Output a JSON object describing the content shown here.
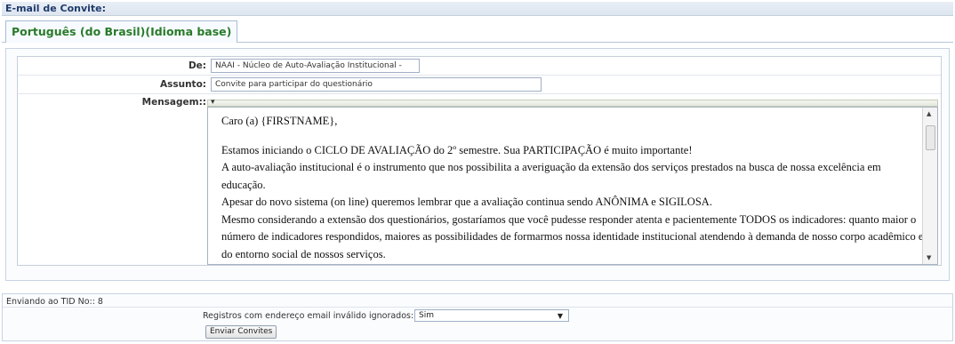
{
  "section_title": "E-mail de Convite:",
  "language_tab": "Português (do Brasil)(Idioma base)",
  "form": {
    "from_label": "De:",
    "from_value": "NAAI - Núcleo de Auto-Avaliação Institucional -",
    "subject_label": "Assunto:",
    "subject_value": "Convite para participar do questionário",
    "message_label": "Mensagem::",
    "message_lines": [
      "Caro (a) {FIRSTNAME},",
      "",
      "Estamos iniciando o CICLO DE AVALIAÇÃO do 2º semestre. Sua PARTICIPAÇÃO é muito importante!",
      "A auto-avaliação institucional é o instrumento que nos possibilita a averiguação da extensão dos serviços prestados na busca de nossa excelência em",
      "educação.",
      "Apesar do novo sistema (on line) queremos lembrar que a avaliação continua sendo ANÔNIMA e SIGILOSA.",
      "Mesmo considerando a extensão dos questionários, gostaríamos que você pudesse responder atenta e pacientemente TODOS os indicadores: quanto maior o",
      "número de indicadores respondidos, maiores as possibilidades de formarmos nossa identidade institucional atendendo à demanda de nosso corpo acadêmico e",
      "do entorno social de nossos serviços."
    ]
  },
  "send": {
    "tid_text": "Enviando ao TID No:: 8",
    "invalid_label": "Registros com endereço email inválido ignorados:",
    "invalid_value": "Sim",
    "button_label": "Enviar Convites"
  }
}
